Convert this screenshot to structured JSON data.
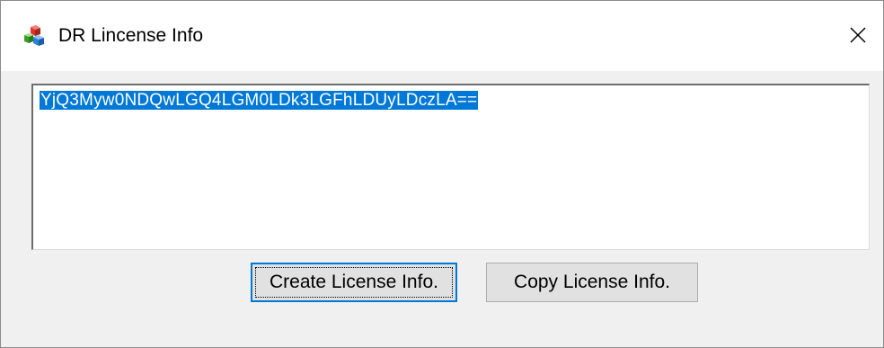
{
  "window": {
    "title": "DR Lincense Info",
    "icon": "app-cubes-icon",
    "close_icon": "close-icon"
  },
  "license_field": {
    "value": "YjQ3Myw0NDQwLGQ4LGM0LDk3LGFhLDUyLDczLA==",
    "selected": true
  },
  "buttons": {
    "create_label": "Create License Info.",
    "copy_label": "Copy License Info."
  },
  "colors": {
    "selection": "#0078d7",
    "button_face": "#e1e1e1",
    "dialog_bg": "#f0f0f0"
  }
}
